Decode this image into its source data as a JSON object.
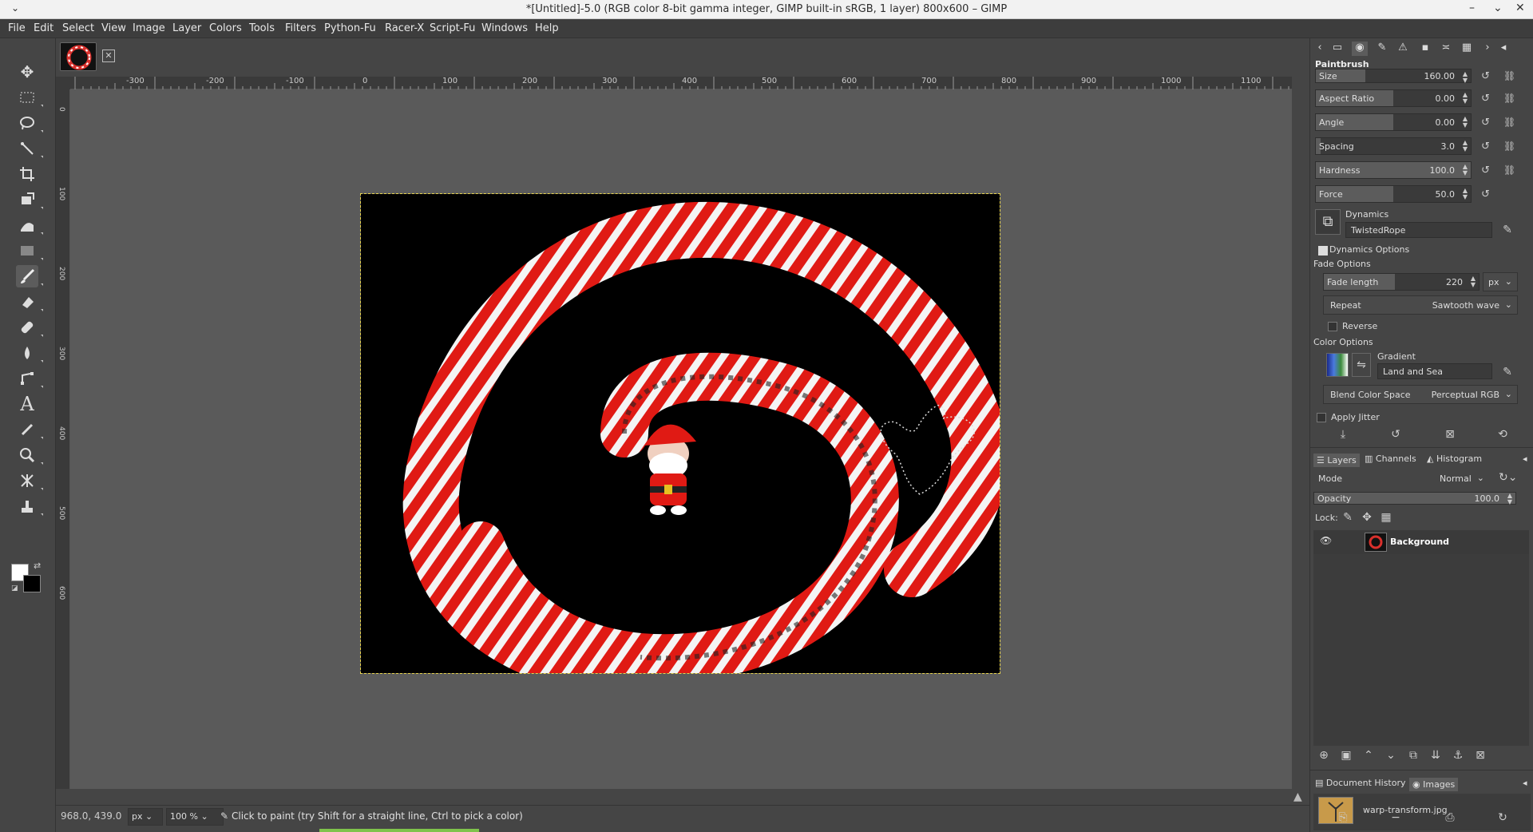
{
  "window": {
    "title": "*[Untitled]-5.0 (RGB color 8-bit gamma integer, GIMP built-in sRGB, 1 layer) 800x600 – GIMP",
    "menu_glyph": "⌄",
    "min": "–",
    "max": "⌄",
    "close": "✕"
  },
  "menubar": [
    "File",
    "Edit",
    "Select",
    "View",
    "Image",
    "Layer",
    "Colors",
    "Tools",
    "Filters",
    "Python-Fu",
    "Racer-X",
    "Script-Fu",
    "Windows",
    "Help"
  ],
  "ruler_top": [
    "-300",
    "-200",
    "-100",
    "0",
    "100",
    "200",
    "300",
    "400",
    "500",
    "600",
    "700",
    "800",
    "900",
    "1000",
    "1100"
  ],
  "ruler_left": [
    "0",
    "100",
    "200",
    "300",
    "400",
    "500",
    "600"
  ],
  "status": {
    "coords": "968.0, 439.0",
    "unit": "px",
    "zoom": "100 %",
    "message": "Click to paint (try Shift for a straight line, Ctrl to pick a color)"
  },
  "tool_options": {
    "title": "Paintbrush",
    "sliders": [
      {
        "label": "Size",
        "value": "160.00",
        "fraction": 0.32
      },
      {
        "label": "Aspect Ratio",
        "value": "0.00",
        "fraction": 0.5
      },
      {
        "label": "Angle",
        "value": "0.00",
        "fraction": 0.5
      },
      {
        "label": "Spacing",
        "value": "3.0",
        "fraction": 0.03
      },
      {
        "label": "Hardness",
        "value": "100.0",
        "fraction": 1.0
      },
      {
        "label": "Force",
        "value": "50.0",
        "fraction": 0.5
      }
    ],
    "dynamics_label": "Dynamics",
    "dynamics_value": "TwistedRope",
    "dynamics_options": "Dynamics Options",
    "fade_options": "Fade Options",
    "fade_length_label": "Fade length",
    "fade_length_value": "220",
    "fade_unit": "px",
    "repeat_label": "Repeat",
    "repeat_value": "Sawtooth wave",
    "reverse_label": "Reverse",
    "color_options": "Color Options",
    "gradient_label": "Gradient",
    "gradient_value": "Land and Sea",
    "blend_label": "Blend Color Space",
    "blend_value": "Perceptual RGB",
    "apply_jitter": "Apply Jitter"
  },
  "layers": {
    "tabs": [
      "Layers",
      "Channels",
      "Histogram"
    ],
    "mode_label": "Mode",
    "mode_value": "Normal",
    "opacity_label": "Opacity",
    "opacity_value": "100.0",
    "lock_label": "Lock:",
    "layer_name": "Background"
  },
  "history": {
    "tabs": [
      "Document History",
      "Images"
    ],
    "item": "warp-transform.jpg"
  }
}
